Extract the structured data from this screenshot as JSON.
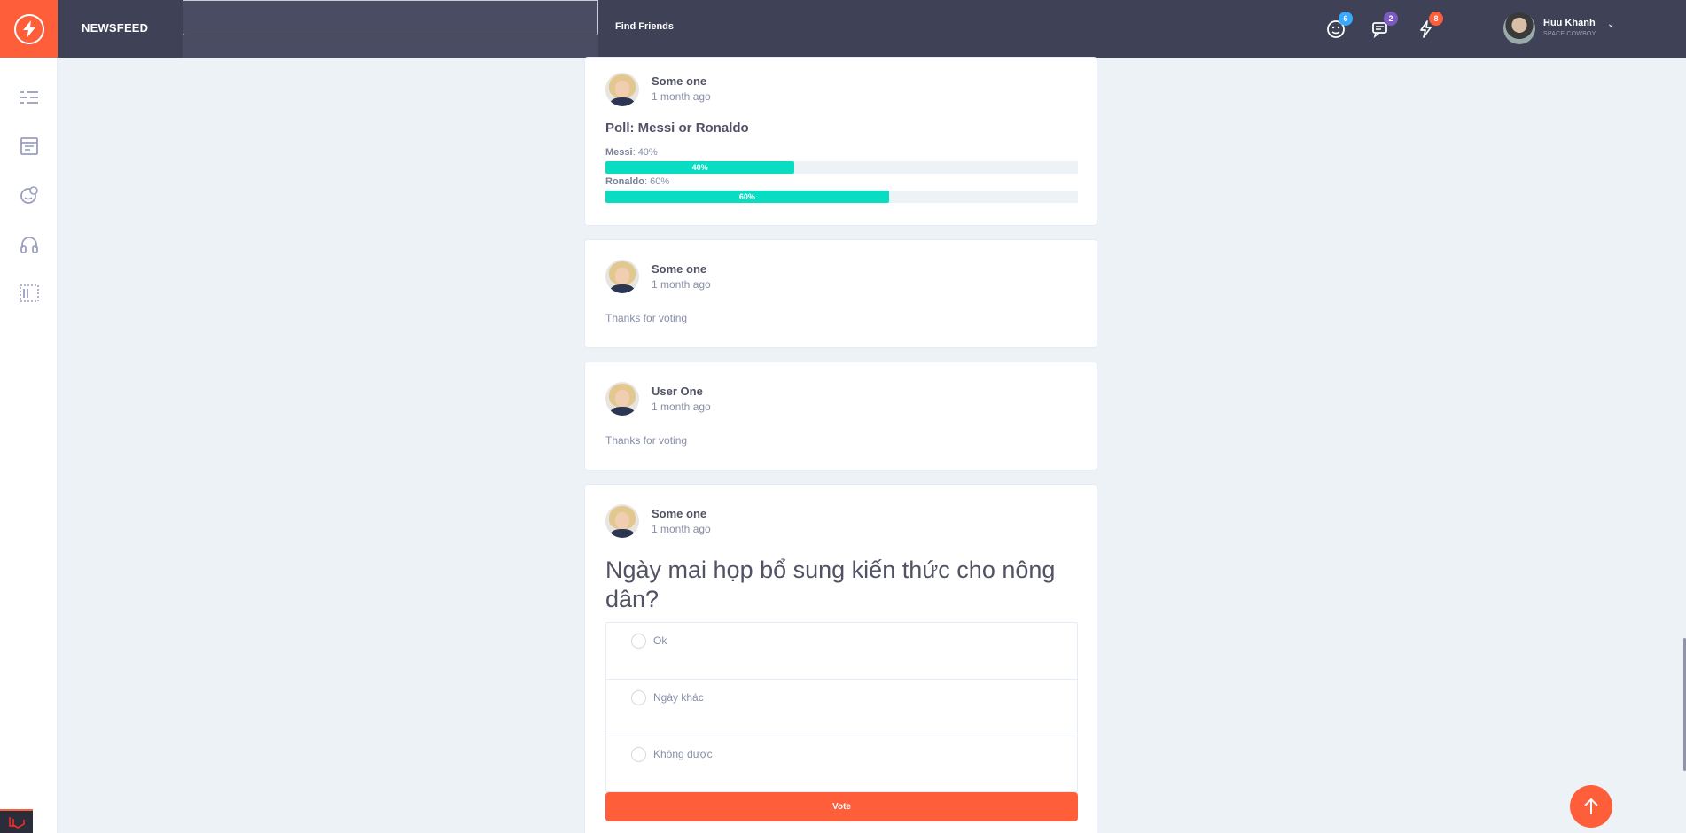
{
  "header": {
    "page_title": "NEWSFEED",
    "search_value": "",
    "find_friends": "Find Friends",
    "badges": {
      "friends": "6",
      "messages": "2",
      "notifications": "8"
    },
    "user_name": "Huu Khanh",
    "user_subtitle": "SPACE COWBOY",
    "caret": "⌄"
  },
  "colors": {
    "header_bg": "#3f4257",
    "accent": "#ff5e3a",
    "poll_bar": "#08ddc1",
    "badge_blue": "#38a9ff",
    "badge_purple": "#7c5ac2",
    "badge_orange": "#ff5e3a"
  },
  "sidebar": {
    "icons": [
      "menu-icon",
      "newsfeed-icon",
      "faces-icon",
      "headphones-icon",
      "widgets-icon"
    ]
  },
  "posts": [
    {
      "author": "Some one",
      "time": "1 month ago",
      "poll_title": "Poll: Messi or Ronaldo",
      "options": [
        {
          "name": "Messi",
          "suffix": ": 40%",
          "percent": 40,
          "bar_label": "40%"
        },
        {
          "name": "Ronaldo",
          "suffix": ": 60%",
          "percent": 60,
          "bar_label": "60%"
        }
      ]
    },
    {
      "author": "Some one",
      "time": "1 month ago",
      "text": "Thanks for voting"
    },
    {
      "author": "User One",
      "time": "1 month ago",
      "text": "Thanks for voting"
    },
    {
      "author": "Some one",
      "time": "1 month ago",
      "question": "Ngày mai họp bổ sung kiến thức cho nông dân?",
      "vote_options": [
        "Ok",
        "Ngày khác",
        "Không được"
      ],
      "vote_label": "Vote"
    }
  ]
}
